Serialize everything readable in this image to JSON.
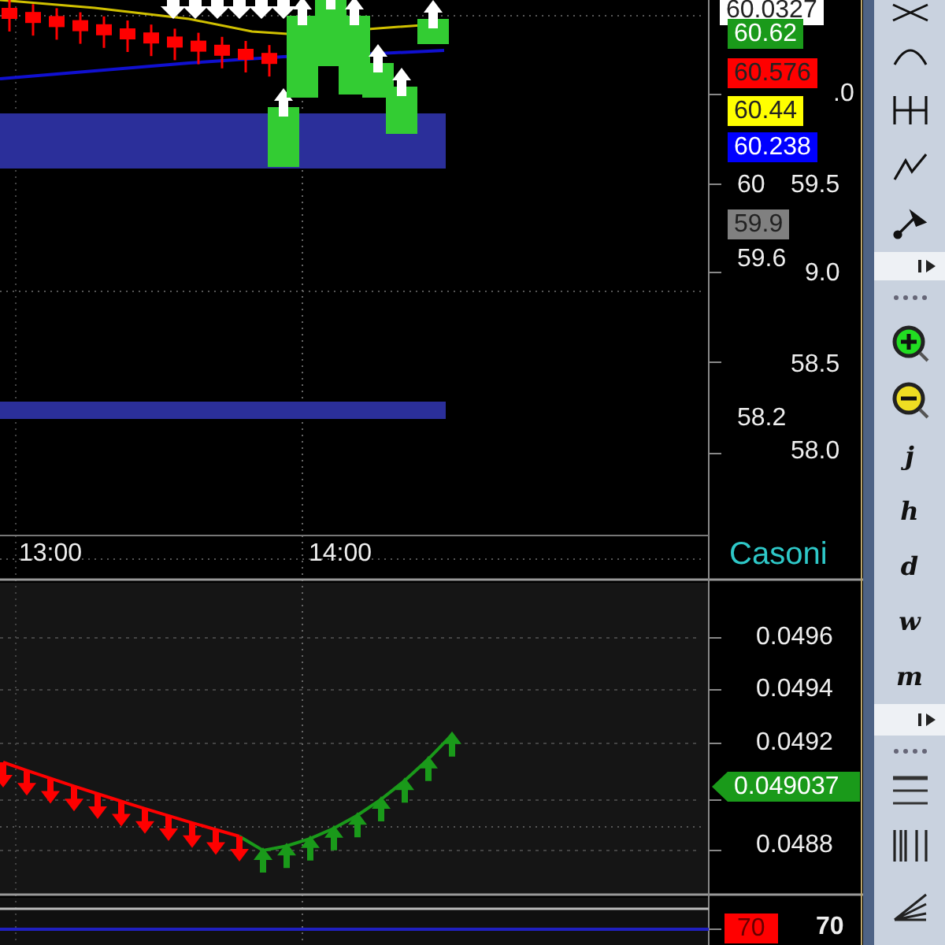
{
  "price_chart": {
    "price_tags": [
      {
        "text": "60.0327",
        "color": "#ffffff"
      },
      {
        "text": "60.62",
        "color": "#1a9a1a"
      },
      {
        "text": "60.576",
        "color": "#ff0000"
      },
      {
        "text": "60.44",
        "color": "#ffff00"
      },
      {
        "text": "60.238",
        "color": "#0000ff"
      },
      {
        "text": "59.9",
        "color": "#808080"
      }
    ],
    "axis_labels": [
      ".0",
      "60",
      "59.5",
      "59.6",
      "9.0",
      "58.5",
      "58.2",
      "58.0"
    ],
    "time_labels": [
      "13:00",
      "14:00"
    ],
    "legend": "Casoni"
  },
  "indicator_panel": {
    "axis_labels": [
      "0.0496",
      "0.0494",
      "0.0492",
      "0.0488"
    ],
    "current_value": "0.049037"
  },
  "bottom_panel": {
    "value_tag": "70",
    "axis_label": "70"
  },
  "toolbar": {
    "period_buttons": [
      "j",
      "h",
      "d",
      "w",
      "m"
    ]
  }
}
